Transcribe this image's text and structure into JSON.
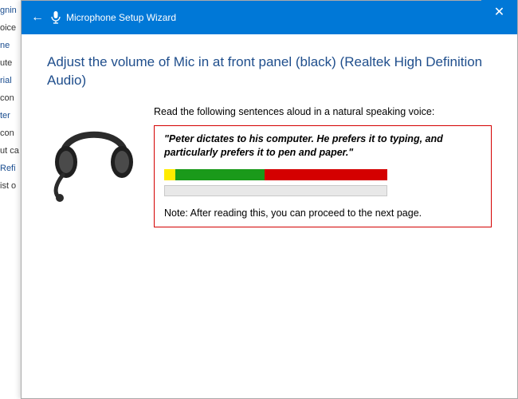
{
  "left_fragments": [
    "gnin",
    "oice",
    "ne",
    "ute",
    "rial",
    "con",
    "ter",
    "con",
    "ut ca",
    "Refi",
    "ist o"
  ],
  "titlebar": {
    "title": "Microphone Setup Wizard",
    "back_label": "←",
    "close_label": "✕"
  },
  "heading": "Adjust the volume of Mic in at front panel (black) (Realtek High Definition Audio)",
  "instruction": "Read the following sentences aloud in a natural speaking voice:",
  "sample_text": "\"Peter dictates to his computer. He prefers it to typing, and particularly prefers it to pen and paper.\"",
  "note_text": "Note: After reading this, you can proceed to the next page.",
  "meter": {
    "yellow_pct": 5,
    "green_pct": 40,
    "red_pct": 55
  }
}
